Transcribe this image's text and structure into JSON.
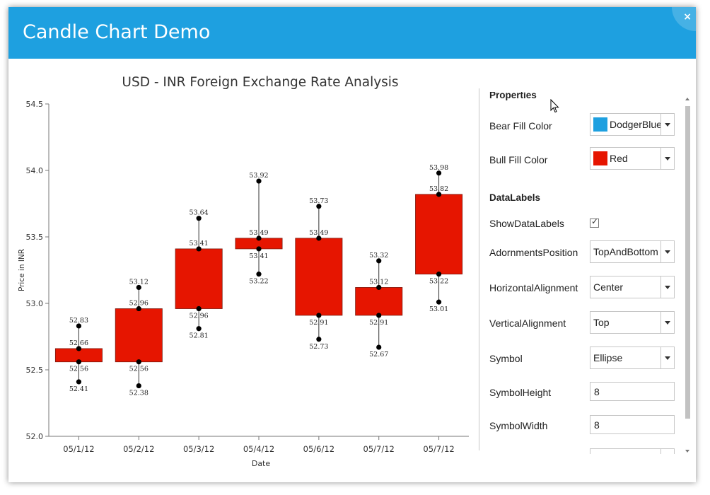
{
  "window": {
    "title": "Candle Chart Demo",
    "close_label": "×"
  },
  "chart_data": {
    "type": "candlestick",
    "title": "USD - INR Foreign Exchange Rate Analysis",
    "xlabel": "Date",
    "ylabel": "Price in INR",
    "ylim": [
      52.0,
      54.5
    ],
    "yticks": [
      "52.0",
      "52.5",
      "53.0",
      "53.5",
      "54.0",
      "54.5"
    ],
    "categories": [
      "05/1/12",
      "05/2/12",
      "05/3/12",
      "05/4/12",
      "05/6/12",
      "05/7/12",
      "05/7/12"
    ],
    "series": [
      {
        "candles": [
          {
            "high": 52.83,
            "low": 52.41,
            "open": 52.66,
            "close": 52.56,
            "high_label": "52.83",
            "low_label": "52.41",
            "open_label": "52.66",
            "close_label": "52.56"
          },
          {
            "high": 53.12,
            "low": 52.38,
            "open": 52.96,
            "close": 52.56,
            "high_label": "53.12",
            "low_label": "52.38",
            "open_label": "52.96",
            "close_label": "52.56"
          },
          {
            "high": 53.64,
            "low": 52.81,
            "open": 53.41,
            "close": 52.96,
            "high_label": "53.64",
            "low_label": "52.81",
            "open_label": "53.41",
            "close_label": "52.96"
          },
          {
            "high": 53.92,
            "low": 53.22,
            "open": 53.49,
            "close": 53.41,
            "high_label": "53.92",
            "low_label": "53.22",
            "open_label": "53.49",
            "close_label": "53.41"
          },
          {
            "high": 53.73,
            "low": 52.73,
            "open": 53.49,
            "close": 52.91,
            "high_label": "53.73",
            "low_label": "52.73",
            "open_label": "53.49",
            "close_label": "52.91"
          },
          {
            "high": 53.32,
            "low": 52.67,
            "open": 53.12,
            "close": 52.91,
            "high_label": "53.32",
            "low_label": "52.67",
            "open_label": "53.12",
            "close_label": "52.91"
          },
          {
            "high": 53.98,
            "low": 53.01,
            "open": 53.82,
            "close": 53.22,
            "high_label": "53.98",
            "low_label": "53.01",
            "open_label": "53.82",
            "close_label": "53.22"
          }
        ]
      }
    ],
    "box_color": "#e61500",
    "show_data_labels": true,
    "legend": "none",
    "grid": false
  },
  "properties": {
    "heading": "Properties",
    "bear_fill": {
      "label": "Bear Fill Color",
      "value": "DodgerBlue",
      "swatch": "#1ea0e0"
    },
    "bull_fill": {
      "label": "Bull Fill Color",
      "value": "Red",
      "swatch": "#e61500"
    },
    "datalabels_heading": "DataLabels",
    "show_data_labels": {
      "label": "ShowDataLabels",
      "checked": true,
      "check_glyph": "✓"
    },
    "adornments_position": {
      "label": "AdornmentsPosition",
      "value": "TopAndBottom"
    },
    "horizontal_alignment": {
      "label": "HorizontalAlignment",
      "value": "Center"
    },
    "vertical_alignment": {
      "label": "VerticalAlignment",
      "value": "Top"
    },
    "symbol": {
      "label": "Symbol",
      "value": "Ellipse"
    },
    "symbol_height": {
      "label": "SymbolHeight",
      "value": "8"
    },
    "symbol_width": {
      "label": "SymbolWidth",
      "value": "8"
    }
  }
}
